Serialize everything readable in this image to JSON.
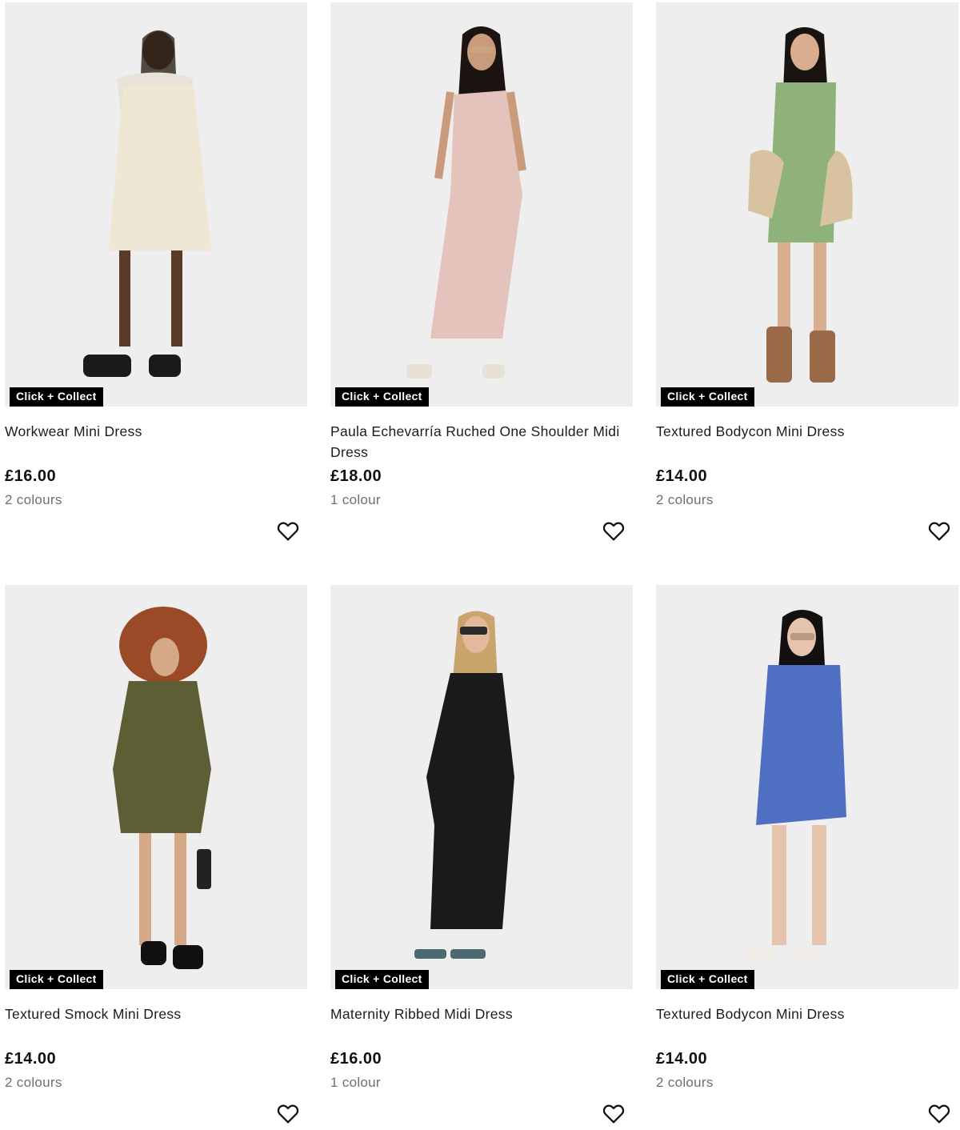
{
  "products": [
    {
      "badge": "Click + Collect",
      "title": "Workwear Mini Dress",
      "price": "£16.00",
      "colours": "2 colours",
      "dress_color": "#efe6d4",
      "skin": "#5a3a28",
      "hair": "#2a2018"
    },
    {
      "badge": "Click + Collect",
      "title": "Paula Echevarría Ruched One Shoulder Midi Dress",
      "price": "£18.00",
      "colours": "1 colour",
      "dress_color": "#e4c3bd",
      "skin": "#c99a7c",
      "hair": "#1c1410"
    },
    {
      "badge": "Click + Collect",
      "title": "Textured Bodycon Mini Dress",
      "price": "£14.00",
      "colours": "2 colours",
      "dress_color": "#8fb27a",
      "skin": "#d8ad90",
      "hair": "#1a1410"
    },
    {
      "badge": "Click + Collect",
      "title": "Textured Smock Mini Dress",
      "price": "£14.00",
      "colours": "2 colours",
      "dress_color": "#5e5e34",
      "skin": "#d5a888",
      "hair": "#9a4a26"
    },
    {
      "badge": "Click + Collect",
      "title": "Maternity Ribbed Midi Dress",
      "price": "£16.00",
      "colours": "1 colour",
      "dress_color": "#1a1a1a",
      "skin": "#e2b99a",
      "hair": "#c9a46c"
    },
    {
      "badge": "Click + Collect",
      "title": "Textured Bodycon Mini Dress",
      "price": "£14.00",
      "colours": "2 colours",
      "dress_color": "#4f6fc2",
      "skin": "#e6c3ad",
      "hair": "#141010"
    }
  ],
  "icons": {
    "favourite": "heart-outline-icon"
  },
  "colors": {
    "badge_bg": "#000000",
    "image_bg": "#eeeeee",
    "secondary_text": "#6f6f6f"
  }
}
